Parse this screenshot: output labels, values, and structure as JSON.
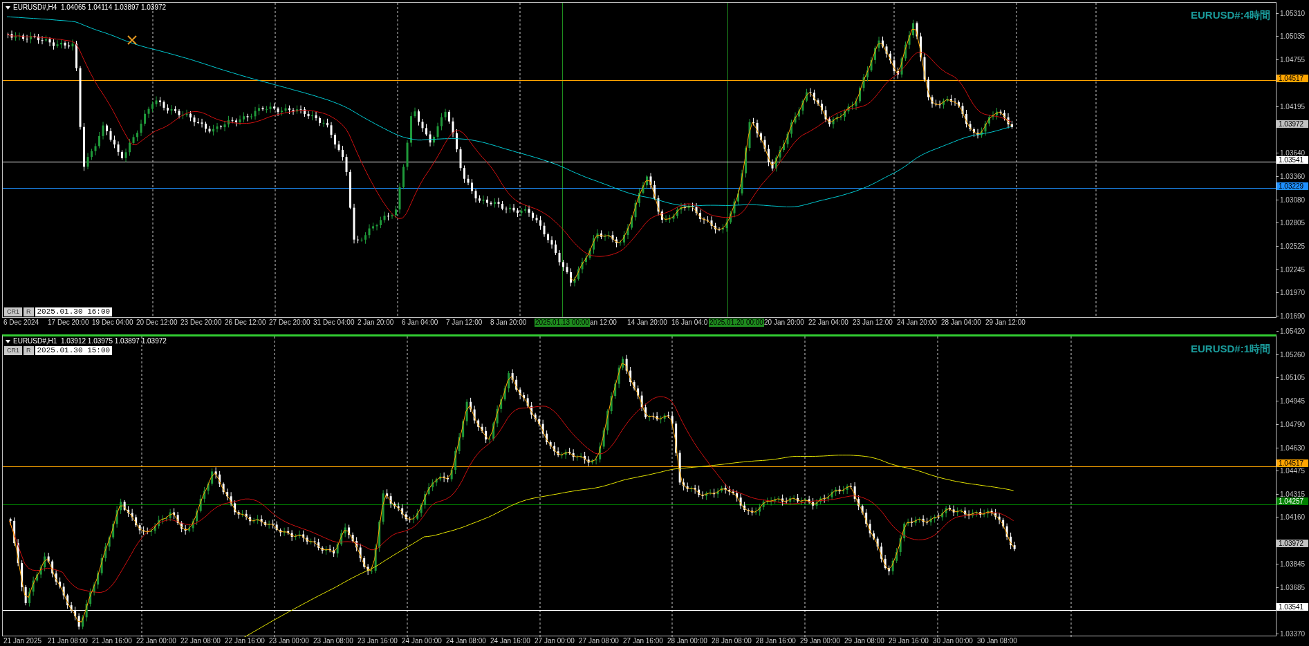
{
  "charts": [
    {
      "header": "EURUSD#,H4  1.04065 1.04114 1.03897 1.03972",
      "title": "EURUSD#:4時間",
      "active": false,
      "cr_button": "CR1",
      "r_button": "R",
      "date_field": "2025.01.30 16:00",
      "price_ticks": [
        "1.05310",
        "1.05035",
        "1.04755",
        "1.04195",
        "1.03640",
        "1.03360",
        "1.03080",
        "1.02805",
        "1.02525",
        "1.02245",
        "1.01970",
        "1.01690"
      ],
      "price_labels": [
        {
          "value": "1.04517",
          "color": "#ffa500",
          "line": true
        },
        {
          "value": "1.03972",
          "color": "#c0c0c0",
          "line": false
        },
        {
          "value": "1.03541",
          "color": "#ffffff",
          "line": true
        },
        {
          "value": "1.03229",
          "color": "#1e90ff",
          "line": true
        }
      ],
      "time_labels": [
        {
          "text": "6 Dec 2024",
          "kind": "tick"
        },
        {
          "text": "17 Dec 20:00",
          "kind": "tick"
        },
        {
          "text": "19 Dec 04:00",
          "kind": "tick"
        },
        {
          "text": "20 Dec 12:00",
          "kind": "tick"
        },
        {
          "text": "23 Dec 20:00",
          "kind": "tick"
        },
        {
          "text": "26 Dec 12:00",
          "kind": "tick"
        },
        {
          "text": "27 Dec 20:00",
          "kind": "tick"
        },
        {
          "text": "31 Dec 04:00",
          "kind": "tick"
        },
        {
          "text": "2 Jan 20:00",
          "kind": "tick"
        },
        {
          "text": "6 Jan 04:00",
          "kind": "tick"
        },
        {
          "text": "7 Jan 12:00",
          "kind": "tick"
        },
        {
          "text": "8 Jan 20:00",
          "kind": "tick"
        },
        {
          "text": "2025.01.13 00:00",
          "kind": "highlight"
        },
        {
          "text": "an 12:00",
          "kind": "partial"
        },
        {
          "text": "14 Jan 20:00",
          "kind": "tick"
        },
        {
          "text": "16 Jan 04:0",
          "kind": "partial"
        },
        {
          "text": "2025.01.20 00:00",
          "kind": "highlight"
        },
        {
          "text": "20 Jan 20:00",
          "kind": "tick"
        },
        {
          "text": "22 Jan 04:00",
          "kind": "tick"
        },
        {
          "text": "23 Jan 12:00",
          "kind": "tick"
        },
        {
          "text": "24 Jan 20:00",
          "kind": "tick"
        },
        {
          "text": "28 Jan 04:00",
          "kind": "tick"
        },
        {
          "text": "29 Jan 12:00",
          "kind": "tick"
        }
      ]
    },
    {
      "header": "EURUSD#,H1  1.03912 1.03975 1.03897 1.03972",
      "title": "EURUSD#:1時間",
      "active": true,
      "cr_button": "CR1",
      "r_button": "R",
      "date_field": "2025.01.30 15:00",
      "price_ticks": [
        "1.05420",
        "1.05260",
        "1.05105",
        "1.04945",
        "1.04790",
        "1.04630",
        "1.04475",
        "1.04315",
        "1.04160",
        "1.03845",
        "1.03685",
        "1.03370"
      ],
      "price_labels": [
        {
          "value": "1.04517",
          "color": "#ffa500",
          "line": true
        },
        {
          "value": "1.04257",
          "color": "#008000",
          "line": true
        },
        {
          "value": "1.03972",
          "color": "#c0c0c0",
          "line": false
        },
        {
          "value": "1.03541",
          "color": "#ffffff",
          "line": true
        }
      ],
      "time_labels": [
        {
          "text": "21 Jan 2025",
          "kind": "tick"
        },
        {
          "text": "21 Jan 08:00",
          "kind": "tick"
        },
        {
          "text": "21 Jan 16:00",
          "kind": "tick"
        },
        {
          "text": "22 Jan 00:00",
          "kind": "tick"
        },
        {
          "text": "22 Jan 08:00",
          "kind": "tick"
        },
        {
          "text": "22 Jan 16:00",
          "kind": "tick"
        },
        {
          "text": "23 Jan 00:00",
          "kind": "tick"
        },
        {
          "text": "23 Jan 08:00",
          "kind": "tick"
        },
        {
          "text": "23 Jan 16:00",
          "kind": "tick"
        },
        {
          "text": "24 Jan 00:00",
          "kind": "tick"
        },
        {
          "text": "24 Jan 08:00",
          "kind": "tick"
        },
        {
          "text": "24 Jan 16:00",
          "kind": "tick"
        },
        {
          "text": "27 Jan 00:00",
          "kind": "tick"
        },
        {
          "text": "27 Jan 08:00",
          "kind": "tick"
        },
        {
          "text": "27 Jan 16:00",
          "kind": "tick"
        },
        {
          "text": "28 Jan 00:00",
          "kind": "tick"
        },
        {
          "text": "28 Jan 08:00",
          "kind": "tick"
        },
        {
          "text": "28 Jan 16:00",
          "kind": "tick"
        },
        {
          "text": "29 Jan 00:00",
          "kind": "tick"
        },
        {
          "text": "29 Jan 08:00",
          "kind": "tick"
        },
        {
          "text": "29 Jan 16:00",
          "kind": "tick"
        },
        {
          "text": "30 Jan 00:00",
          "kind": "tick"
        },
        {
          "text": "30 Jan 08:00",
          "kind": "tick"
        }
      ]
    }
  ]
}
